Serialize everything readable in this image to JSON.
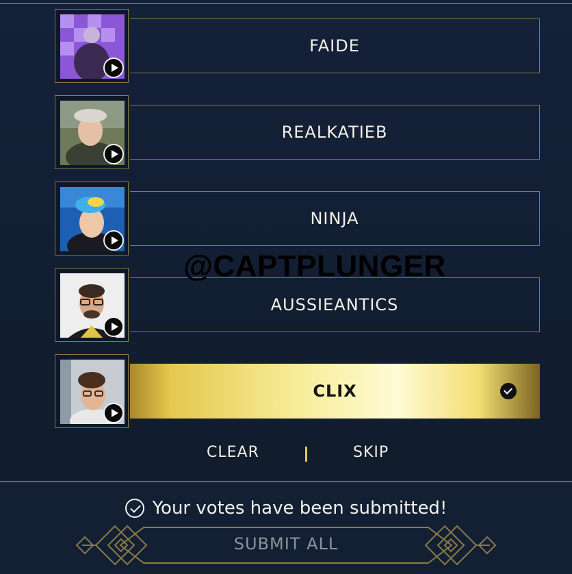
{
  "watermark": "@CAPTPLUNGER",
  "candidates": [
    {
      "name": "FAIDE",
      "selected": false
    },
    {
      "name": "REALKATIEB",
      "selected": false
    },
    {
      "name": "NINJA",
      "selected": false
    },
    {
      "name": "AUSSIEANTICS",
      "selected": false
    },
    {
      "name": "CLIX",
      "selected": true
    }
  ],
  "actions": {
    "clear": "CLEAR",
    "skip": "SKIP"
  },
  "status": {
    "message": "Your votes have been submitted!"
  },
  "submit": {
    "label": "SUBMIT ALL"
  },
  "colors": {
    "background": "#132033",
    "gold_border": "#8a7a45",
    "gold_fill": "#f6ec97",
    "text": "#f4f1e6"
  }
}
